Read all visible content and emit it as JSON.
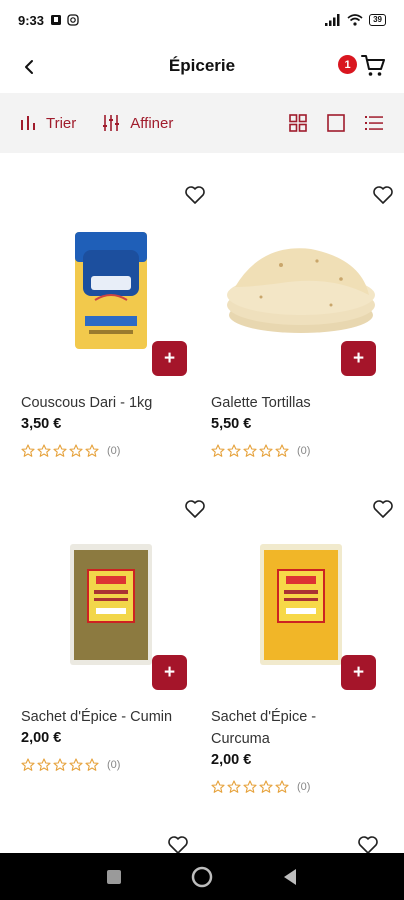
{
  "status_bar": {
    "time": "9:33",
    "battery": "39"
  },
  "header": {
    "title": "Épicerie",
    "cart_count": "1"
  },
  "filters": {
    "sort_label": "Trier",
    "refine_label": "Affiner"
  },
  "products": [
    {
      "name": "Couscous Dari - 1kg",
      "price": "3,50 €",
      "rating_count": "(0)",
      "rating": 0
    },
    {
      "name": "Galette Tortillas",
      "price": "5,50 €",
      "rating_count": "(0)",
      "rating": 0
    },
    {
      "name": "Sachet d'Épice - Cumin",
      "price": "2,00 €",
      "rating_count": "(0)",
      "rating": 0
    },
    {
      "name": "Sachet d'Épice - Curcuma",
      "price": "2,00 €",
      "rating_count": "(0)",
      "rating": 0
    }
  ],
  "colors": {
    "accent": "#a5152a",
    "badge": "#d9161f",
    "star": "#e6a23c",
    "filter_bg": "#f3f3f3"
  }
}
